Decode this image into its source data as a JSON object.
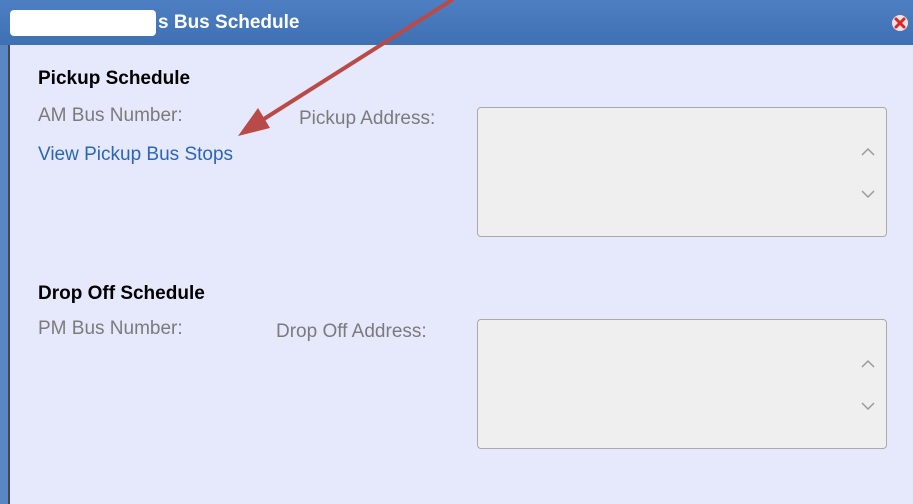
{
  "window": {
    "title": "s Bus Schedule",
    "close_icon": "close-x-icon",
    "accent_color": "#3f70b4",
    "content_background": "#e6e9fb"
  },
  "pickup": {
    "heading": "Pickup Schedule",
    "bus_number_label": "AM Bus Number:",
    "address_label": "Pickup Address:",
    "view_stops_link": "View Pickup Bus Stops",
    "address_value": ""
  },
  "dropoff": {
    "heading": "Drop Off Schedule",
    "bus_number_label": "PM Bus Number:",
    "address_label": "Drop Off Address:",
    "address_value": ""
  },
  "annotation": {
    "arrow_color": "#b94a48"
  }
}
